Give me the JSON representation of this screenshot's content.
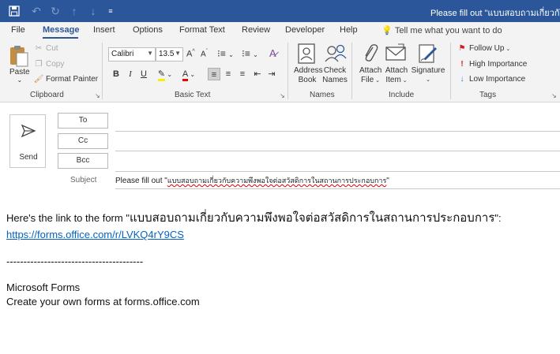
{
  "window": {
    "title": "Please fill out \"แบบสอบถามเกี่ยวกับความพึงพอใจต่อสวัสดิการในสถานการประกอบการ\""
  },
  "ribbon_tabs": [
    "File",
    "Message",
    "Insert",
    "Options",
    "Format Text",
    "Review",
    "Developer",
    "Help"
  ],
  "tell_me": "Tell me what you want to do",
  "clipboard": {
    "paste": "Paste",
    "cut": "Cut",
    "copy": "Copy",
    "format_painter": "Format Painter",
    "label": "Clipboard"
  },
  "basic_text": {
    "font_name": "Calibri",
    "font_size": "13.5",
    "label": "Basic Text"
  },
  "names": {
    "address_book_1": "Address",
    "address_book_2": "Book",
    "check_names_1": "Check",
    "check_names_2": "Names",
    "label": "Names"
  },
  "include": {
    "attach_file_1": "Attach",
    "attach_file_2": "File",
    "attach_item_1": "Attach",
    "attach_item_2": "Item",
    "signature": "Signature",
    "label": "Include"
  },
  "tags": {
    "follow_up": "Follow Up",
    "high_importance": "High Importance",
    "low_importance": "Low Importance",
    "label": "Tags"
  },
  "compose": {
    "send": "Send",
    "to": "To",
    "cc": "Cc",
    "bcc": "Bcc",
    "subject_label": "Subject",
    "subject_prefix": "Please fill out \"",
    "subject_thai": "แบบสอบถามเกี่ยวกับความพึงพอใจต่อสวัสดิการในสถานการประกอบการ",
    "subject_suffix": "\""
  },
  "body": {
    "line1_prefix": "Here's the link to the form \"",
    "line1_thai": "แบบสอบถามเกี่ยวกับความพึงพอใจต่อสวัสดิการในสถานการประกอบการ",
    "line1_suffix": "\":",
    "link": "https://forms.office.com/r/LVKQ4rY9CS",
    "divider": "----------------------------------------",
    "footer1": "Microsoft Forms",
    "footer2": "Create your own forms at forms.office.com"
  },
  "colors": {
    "accent": "#2b579a",
    "link": "#0563c1"
  }
}
